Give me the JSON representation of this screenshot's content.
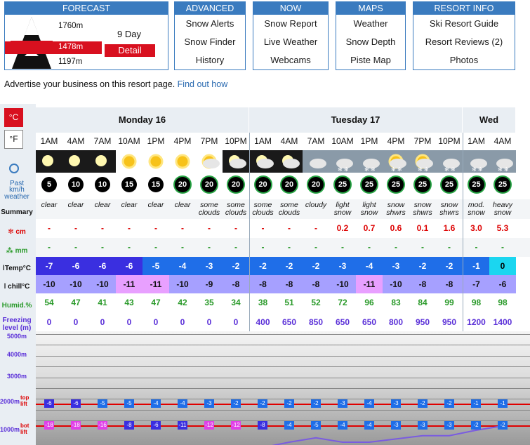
{
  "nav": {
    "forecast": {
      "title": "FORECAST",
      "elev_top": "1760m",
      "elev_mid": "1478m",
      "elev_bot": "1197m",
      "nine_day": "9 Day",
      "detail": "Detail"
    },
    "advanced": {
      "title": "ADVANCED",
      "links": [
        "Snow Alerts",
        "Snow Finder",
        "History"
      ]
    },
    "now": {
      "title": "NOW",
      "links": [
        "Snow Report",
        "Live Weather",
        "Webcams"
      ]
    },
    "maps": {
      "title": "MAPS",
      "links": [
        "Weather",
        "Snow Depth",
        "Piste Map"
      ]
    },
    "resort": {
      "title": "RESORT INFO",
      "links": [
        "Ski Resort Guide",
        "Resort Reviews (2)",
        "Photos"
      ]
    }
  },
  "advertise": {
    "text": "Advertise your business on this resort page.",
    "link": "Find out how"
  },
  "units": {
    "c": "°C",
    "f": "°F"
  },
  "labels": {
    "past": "Past",
    "wind": "km/h",
    "weather": "weather",
    "summary": "Summary",
    "snow": "cm",
    "rain": "mm",
    "temp": "Temp°C",
    "chill": "chill°C",
    "humid": "Humid.%",
    "freezing": "Freezing level (m)",
    "alt": [
      "5000m",
      "4000m",
      "3000m",
      "2000m",
      "1000m"
    ],
    "top_lift": "top lift",
    "bot_lift": "bot lift"
  },
  "days": [
    {
      "name": "Monday 16",
      "span": 8
    },
    {
      "name": "Tuesday 17",
      "span": 8
    },
    {
      "name": "Wed",
      "span": 2
    }
  ],
  "times": [
    "1AM",
    "4AM",
    "7AM",
    "10AM",
    "1PM",
    "4PM",
    "7PM",
    "10PM",
    "1AM",
    "4AM",
    "7AM",
    "10AM",
    "1PM",
    "4PM",
    "7PM",
    "10PM",
    "1AM",
    "4AM"
  ],
  "icons": [
    "moon",
    "moon",
    "moon",
    "sun",
    "sun",
    "sun",
    "sun-cloud",
    "cloud-moon",
    "moon-cloud",
    "moon-cloud",
    "cloud",
    "snow",
    "snow",
    "sun-snow",
    "sun-snow",
    "snow",
    "snow",
    "snow"
  ],
  "wind": [
    "5",
    "10",
    "10",
    "15",
    "15",
    "20",
    "20",
    "20",
    "20",
    "20",
    "20",
    "25",
    "25",
    "25",
    "25",
    "25",
    "25",
    "25"
  ],
  "summary": [
    "clear",
    "clear",
    "clear",
    "clear",
    "clear",
    "clear",
    "some clouds",
    "some clouds",
    "some clouds",
    "some clouds",
    "cloudy",
    "light snow",
    "light snow",
    "snow shwrs",
    "snow shwrs",
    "snow shwrs",
    "mod. snow",
    "heavy snow"
  ],
  "snow": [
    "-",
    "-",
    "-",
    "-",
    "-",
    "-",
    "-",
    "-",
    "-",
    "-",
    "-",
    "0.2",
    "0.7",
    "0.6",
    "0.1",
    "1.6",
    "3.0",
    "5.3"
  ],
  "rain": [
    "-",
    "-",
    "-",
    "-",
    "-",
    "-",
    "-",
    "-",
    "-",
    "-",
    "-",
    "-",
    "-",
    "-",
    "-",
    "-",
    "-",
    "-"
  ],
  "temp": [
    "-7",
    "-6",
    "-6",
    "-6",
    "-5",
    "-4",
    "-3",
    "-2",
    "-2",
    "-2",
    "-2",
    "-3",
    "-4",
    "-3",
    "-2",
    "-2",
    "-1",
    "0"
  ],
  "chill": [
    "-10",
    "-10",
    "-10",
    "-11",
    "-11",
    "-10",
    "-9",
    "-8",
    "-8",
    "-8",
    "-8",
    "-10",
    "-11",
    "-10",
    "-8",
    "-8",
    "-7",
    "-6"
  ],
  "humid": [
    "54",
    "47",
    "41",
    "43",
    "47",
    "42",
    "35",
    "34",
    "38",
    "51",
    "52",
    "72",
    "96",
    "83",
    "84",
    "99",
    "98",
    "98"
  ],
  "freezing": [
    "0",
    "0",
    "0",
    "0",
    "0",
    "0",
    "0",
    "0",
    "400",
    "650",
    "850",
    "650",
    "650",
    "800",
    "950",
    "950",
    "1200",
    "1400"
  ],
  "top_lift_temps": [
    "-6",
    "-6",
    "-5",
    "-5",
    "-4",
    "-4",
    "-3",
    "-2",
    "-2",
    "-2",
    "-2",
    "-3",
    "-4",
    "-3",
    "-2",
    "-2",
    "-1",
    "-1"
  ],
  "bot_lift_temps": [
    "-18",
    "-18",
    "-16",
    "-8",
    "-6",
    "-11",
    "-12",
    "-12",
    "-8",
    "-4",
    "-5",
    "-4",
    "-4",
    "-3",
    "-3",
    "-3",
    "-2",
    "-2"
  ],
  "colors": {
    "brand": "#3a7bbf",
    "detail": "#d8101f",
    "temp_dark": "#3a2fe0",
    "temp_mid": "#1f6ee8",
    "temp_cyan": "#1bd6f0",
    "chill": "#a6a0ff",
    "chill_pink": "#e8a0ff",
    "green": "#2a9a2a",
    "red_text": "#dd0000",
    "freeze_text": "#5a2fd8",
    "lift_line": "#e00000",
    "freeze_line": "#7a5ce0"
  }
}
